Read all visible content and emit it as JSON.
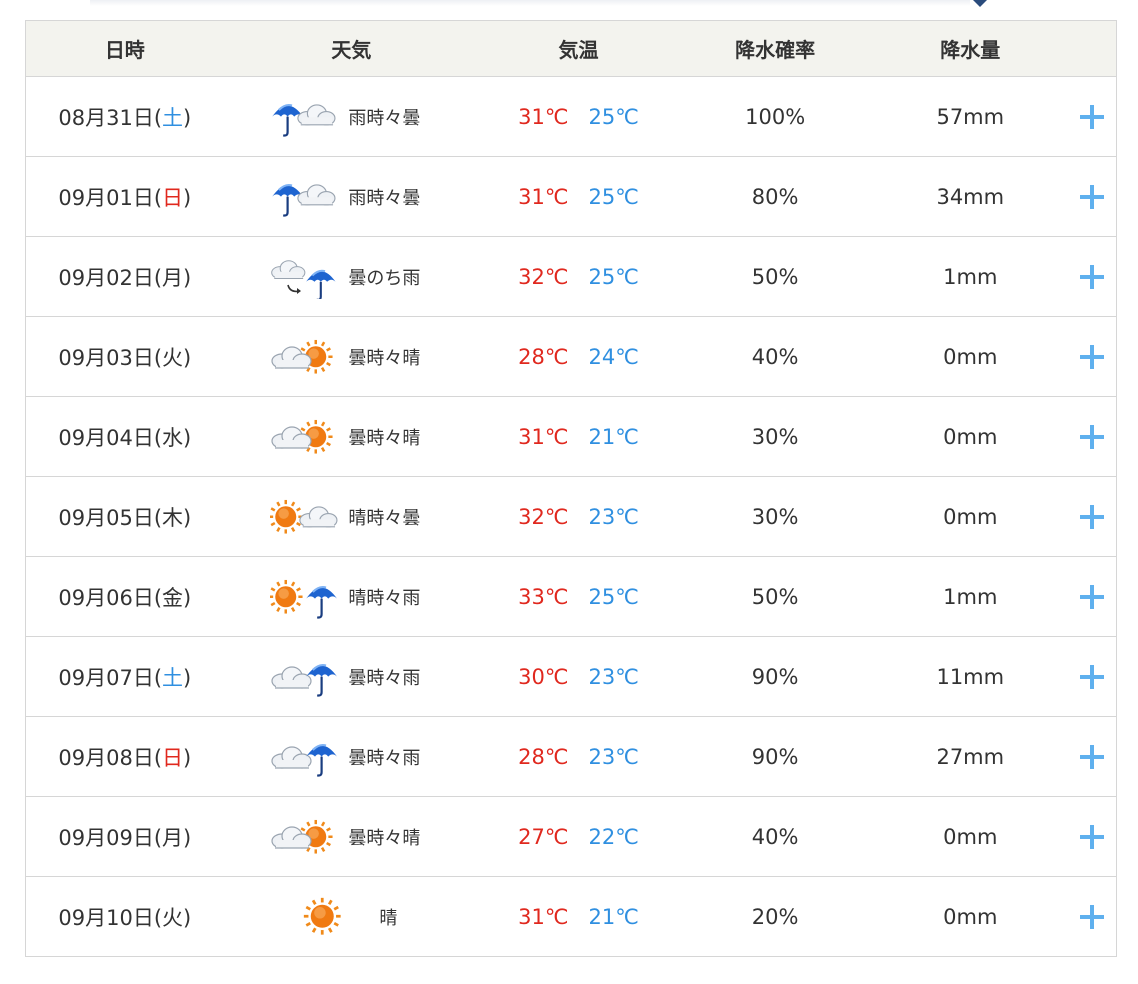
{
  "table": {
    "headers": {
      "date": "日時",
      "weather": "天気",
      "temperature": "気温",
      "precip_probability": "降水確率",
      "precip_amount": "降水量"
    },
    "rows": [
      {
        "date_prefix": "08月31日(",
        "weekday": "土",
        "weekday_type": "sat",
        "date_suffix": ")",
        "icon": "rain-then-cloudy-icon",
        "weather": "雨時々曇",
        "high": "31℃",
        "low": "25℃",
        "pop": "100%",
        "amount": "57mm"
      },
      {
        "date_prefix": "09月01日(",
        "weekday": "日",
        "weekday_type": "sun",
        "date_suffix": ")",
        "icon": "rain-then-cloudy-icon",
        "weather": "雨時々曇",
        "high": "31℃",
        "low": "25℃",
        "pop": "80%",
        "amount": "34mm"
      },
      {
        "date_prefix": "09月02日(",
        "weekday": "月",
        "weekday_type": "weekday",
        "date_suffix": ")",
        "icon": "cloudy-later-rain-icon",
        "weather": "曇のち雨",
        "high": "32℃",
        "low": "25℃",
        "pop": "50%",
        "amount": "1mm"
      },
      {
        "date_prefix": "09月03日(",
        "weekday": "火",
        "weekday_type": "weekday",
        "date_suffix": ")",
        "icon": "cloudy-then-sunny-icon",
        "weather": "曇時々晴",
        "high": "28℃",
        "low": "24℃",
        "pop": "40%",
        "amount": "0mm"
      },
      {
        "date_prefix": "09月04日(",
        "weekday": "水",
        "weekday_type": "weekday",
        "date_suffix": ")",
        "icon": "cloudy-then-sunny-icon",
        "weather": "曇時々晴",
        "high": "31℃",
        "low": "21℃",
        "pop": "30%",
        "amount": "0mm"
      },
      {
        "date_prefix": "09月05日(",
        "weekday": "木",
        "weekday_type": "weekday",
        "date_suffix": ")",
        "icon": "sunny-then-cloudy-icon",
        "weather": "晴時々曇",
        "high": "32℃",
        "low": "23℃",
        "pop": "30%",
        "amount": "0mm"
      },
      {
        "date_prefix": "09月06日(",
        "weekday": "金",
        "weekday_type": "weekday",
        "date_suffix": ")",
        "icon": "sunny-then-rain-icon",
        "weather": "晴時々雨",
        "high": "33℃",
        "low": "25℃",
        "pop": "50%",
        "amount": "1mm"
      },
      {
        "date_prefix": "09月07日(",
        "weekday": "土",
        "weekday_type": "sat",
        "date_suffix": ")",
        "icon": "cloudy-then-rain-icon",
        "weather": "曇時々雨",
        "high": "30℃",
        "low": "23℃",
        "pop": "90%",
        "amount": "11mm"
      },
      {
        "date_prefix": "09月08日(",
        "weekday": "日",
        "weekday_type": "sun",
        "date_suffix": ")",
        "icon": "cloudy-then-rain-icon",
        "weather": "曇時々雨",
        "high": "28℃",
        "low": "23℃",
        "pop": "90%",
        "amount": "27mm"
      },
      {
        "date_prefix": "09月09日(",
        "weekday": "月",
        "weekday_type": "weekday",
        "date_suffix": ")",
        "icon": "cloudy-then-sunny-icon",
        "weather": "曇時々晴",
        "high": "27℃",
        "low": "22℃",
        "pop": "40%",
        "amount": "0mm"
      },
      {
        "date_prefix": "09月10日(",
        "weekday": "火",
        "weekday_type": "weekday",
        "date_suffix": ")",
        "icon": "sunny-icon",
        "weather": "晴",
        "high": "31℃",
        "low": "21℃",
        "pop": "20%",
        "amount": "0mm"
      }
    ]
  },
  "colors": {
    "high_temp": "#e0281e",
    "low_temp": "#2f8fe0",
    "saturday": "#2f8fe0",
    "sunday": "#e0281e",
    "expand_icon": "#5fb0ee",
    "header_bg": "#f3f3ee",
    "border": "#d6d6d6"
  },
  "expand_icon": "plus-icon"
}
